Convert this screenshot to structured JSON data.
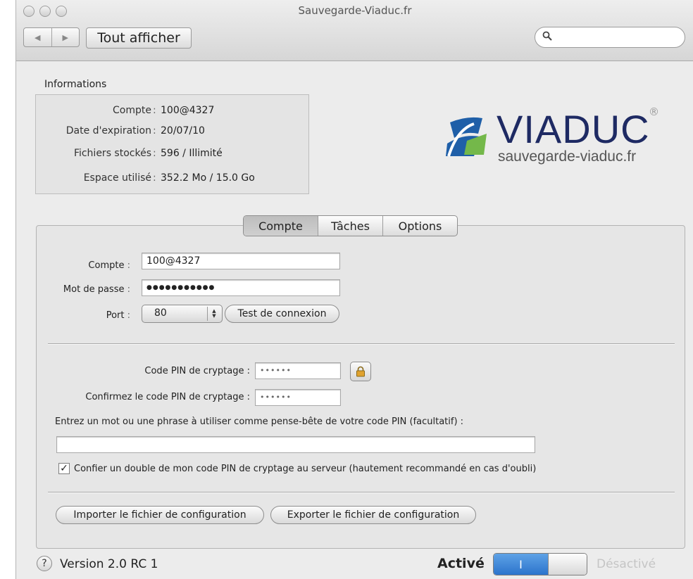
{
  "window": {
    "title": "Sauvegarde-Viaduc.fr",
    "nav_back_icon": "◀",
    "nav_forward_icon": "▶",
    "show_all_label": "Tout afficher",
    "search_placeholder": ""
  },
  "info": {
    "group_label": "Informations",
    "rows": [
      {
        "label": "Compte",
        "value": "100@4327"
      },
      {
        "label": "Date d'expiration",
        "value": "20/07/10"
      },
      {
        "label": "Fichiers stockés",
        "value": "596 / Illimité"
      },
      {
        "label": "Espace utilisé",
        "value": "352.2 Mo / 15.0 Go"
      }
    ]
  },
  "logo": {
    "wordmark": "VIADUC",
    "registered": "®",
    "url": "sauvegarde-viaduc.fr",
    "colors": {
      "blue": "#1f5fa8",
      "green": "#74b84a",
      "navy": "#1e2a63"
    }
  },
  "tabs": [
    {
      "label": "Compte",
      "active": true
    },
    {
      "label": "Tâches",
      "active": false
    },
    {
      "label": "Options",
      "active": false
    }
  ],
  "account": {
    "compte_label": "Compte",
    "compte_value": "100@4327",
    "password_label": "Mot de passe",
    "password_value": "●●●●●●●●●●●",
    "port_label": "Port",
    "port_value": "80",
    "test_button": "Test de connexion"
  },
  "pin": {
    "code_label": "Code PIN de cryptage :",
    "code_value": "••••••",
    "confirm_label": "Confirmez le code PIN de cryptage :",
    "confirm_value": "••••••",
    "hint_label": "Entrez un mot ou une phrase à utiliser comme pense-bête de votre code PIN (facultatif) :",
    "hint_value": "",
    "escrow_checked": true,
    "escrow_label": "Confier un double de mon code PIN de cryptage au serveur (hautement recommandé en cas d'oubli)"
  },
  "config": {
    "import_button": "Importer le fichier de configuration",
    "export_button": "Exporter le fichier de configuration"
  },
  "footer": {
    "help": "?",
    "version": "Version 2.0 RC 1",
    "active_label": "Activé",
    "toggle_on_text": "I",
    "inactive_label": "Désactivé",
    "accent": "#2c74cc"
  }
}
